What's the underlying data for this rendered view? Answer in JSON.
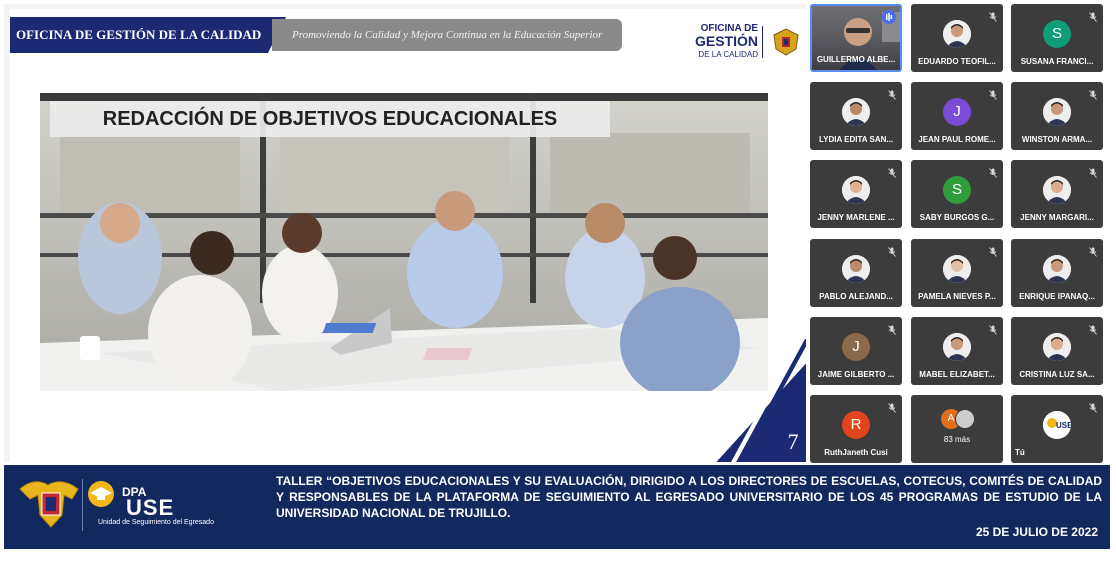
{
  "slide": {
    "header_left": "OFICINA DE GESTIÓN DE LA CALIDAD",
    "header_right": "Promoviendo la Calidad y Mejora Continua en la Educación Superior",
    "logo_line1": "OFICINA DE",
    "logo_line2": "GESTIÓN",
    "logo_line3": "DE LA CALIDAD",
    "title": "REDACCIÓN DE OBJETIVOS EDUCACIONALES",
    "page_number": "7"
  },
  "participants": [
    {
      "name": "GUILLERMO ALBE...",
      "type": "video",
      "speaking": true
    },
    {
      "name": "EDUARDO TEOFIL...",
      "type": "photo",
      "muted": true
    },
    {
      "name": "SUSANA FRANCI...",
      "type": "initial",
      "initial": "S",
      "color": "#0f9d78",
      "muted": true
    },
    {
      "name": "LYDIA EDITA SAN...",
      "type": "photo",
      "muted": true
    },
    {
      "name": "JEAN PAUL ROME...",
      "type": "initial",
      "initial": "J",
      "color": "#7a4bd6",
      "muted": true
    },
    {
      "name": "WINSTON ARMA...",
      "type": "photo",
      "muted": true
    },
    {
      "name": "JENNY MARLENE ...",
      "type": "photo",
      "muted": true
    },
    {
      "name": "SABY BURGOS G...",
      "type": "initial",
      "initial": "S",
      "color": "#2e9d3a",
      "muted": true
    },
    {
      "name": "JENNY MARGARI...",
      "type": "photo",
      "muted": true
    },
    {
      "name": "PABLO ALEJAND...",
      "type": "photo",
      "muted": true
    },
    {
      "name": "PAMELA NIEVES P...",
      "type": "photo",
      "muted": true
    },
    {
      "name": "ENRIQUE IPANAQ...",
      "type": "photo",
      "muted": true
    },
    {
      "name": "JAIME GILBERTO ...",
      "type": "initial",
      "initial": "J",
      "color": "#8a6a4a",
      "muted": true
    },
    {
      "name": "MABEL ELIZABET...",
      "type": "photo",
      "muted": true
    },
    {
      "name": "CRISTINA LUZ SA...",
      "type": "photo",
      "muted": true
    },
    {
      "name": "RuthJaneth Cusi",
      "type": "initial",
      "initial": "R",
      "color": "#e2451d",
      "muted": true
    },
    {
      "name": "83 más",
      "type": "more",
      "initial": "A"
    },
    {
      "name": "Tú",
      "type": "self",
      "muted": true
    }
  ],
  "footer": {
    "dpa": "DPA",
    "use": "USE",
    "use_sub": "Unidad de Seguimiento del Egresado",
    "text": "TALLER “OBJETIVOS EDUCACIONALES Y SU EVALUACIÓN, DIRIGIDO A LOS DIRECTORES DE ESCUELAS, COTECUS, COMITÉS DE CALIDAD Y RESPONSABLES DE LA PLATAFORMA DE SEGUIMIENTO AL EGRESADO UNIVERSITARIO DE LOS 45 PROGRAMAS DE ESTUDIO DE LA UNIVERSIDAD NACIONAL DE TRUJILLO.",
    "date": "25 DE JULIO DE 2022"
  },
  "colors": {
    "navy": "#1c2a73",
    "footer_bg": "#12295f",
    "tile_bg": "#3c3c3c",
    "active_border": "#5b8def"
  }
}
